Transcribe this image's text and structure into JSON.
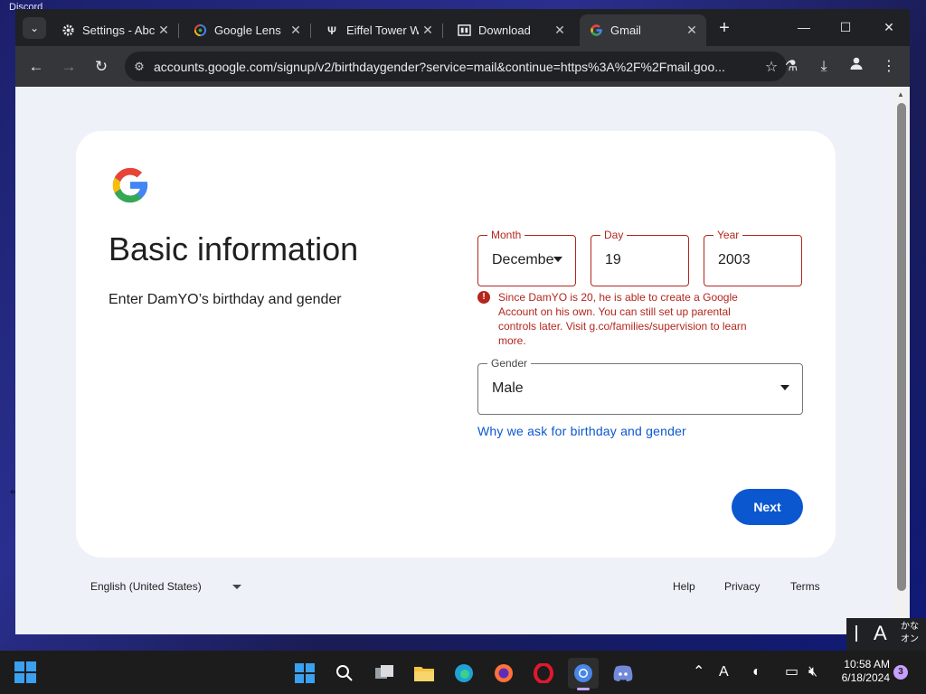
{
  "desktop": {
    "corner_label": "Discord"
  },
  "tabs": [
    {
      "title": "Settings - Abc",
      "icon": "gear-icon",
      "active": false
    },
    {
      "title": "Google Lens",
      "icon": "google-lens-icon",
      "active": false
    },
    {
      "title": "Eiffel Tower W",
      "icon": "eiffel-icon",
      "active": false
    },
    {
      "title": "Download",
      "icon": "download-site-icon",
      "active": false
    },
    {
      "title": "Gmail",
      "icon": "google-icon",
      "active": true
    }
  ],
  "address_bar": {
    "url": "accounts.google.com/signup/v2/birthdaygender?service=mail&continue=https%3A%2F%2Fmail.goo..."
  },
  "page": {
    "headline": "Basic information",
    "subtext": "Enter DamYO’s birthday and gender",
    "month": {
      "label": "Month",
      "value": "December"
    },
    "day": {
      "label": "Day",
      "value": "19"
    },
    "year": {
      "label": "Year",
      "value": "2003"
    },
    "error_message": "Since DamYO is 20, he is able to create a Google Account on his own. You can still set up parental controls later. Visit g.co/families/supervision to learn more.",
    "gender": {
      "label": "Gender",
      "value": "Male"
    },
    "why_link": "Why we ask for birthday and gender",
    "next_button": "Next"
  },
  "footer": {
    "language": "English (United States)",
    "help": "Help",
    "privacy": "Privacy",
    "terms": "Terms"
  },
  "ime": {
    "mode": "A",
    "kana_line1": "かな",
    "kana_line2": "オン"
  },
  "taskbar": {
    "time": "10:58 AM",
    "date": "6/18/2024",
    "notification_count": "3",
    "input_indicator": "A"
  },
  "colors": {
    "accent": "#0b57d0",
    "error": "#b3261e",
    "page_bg": "#eef1f8"
  }
}
